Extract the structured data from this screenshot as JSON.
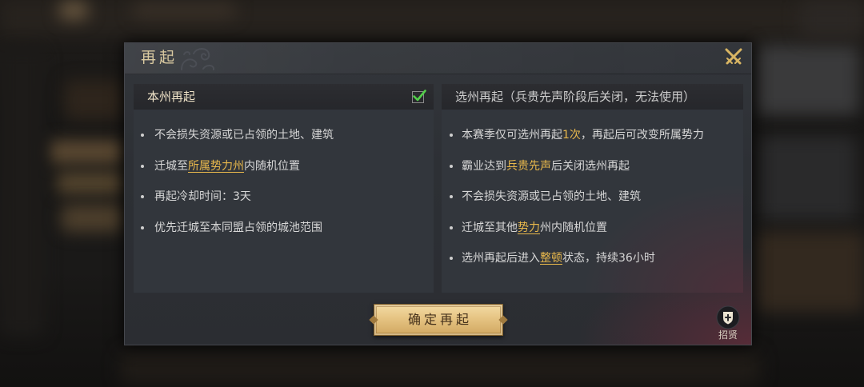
{
  "dialog": {
    "title": "再起",
    "close_icon": "close-crossed-swords-icon"
  },
  "colors": {
    "body_text": "#d6d6d6",
    "highlight": "#e8b84c",
    "title": "#d9c9a0",
    "check": "#52cf4a",
    "button_text": "#44301a"
  },
  "local_revive": {
    "title": "本州再起",
    "selected": true,
    "check_icon": "green-checkmark-icon",
    "items": [
      {
        "parts": [
          {
            "text": "不会损失资源或已占领的土地、建筑"
          }
        ]
      },
      {
        "parts": [
          {
            "text": "迁城至"
          },
          {
            "text": "所属势力州",
            "highlighted": true,
            "underlined": true
          },
          {
            "text": "内随机位置"
          }
        ]
      },
      {
        "parts": [
          {
            "text": "再起冷却时间：3天"
          }
        ]
      },
      {
        "parts": [
          {
            "text": "优先迁城至本同盟占领的城池范围"
          }
        ]
      }
    ]
  },
  "choose_state_revive": {
    "title": "选州再起（兵贵先声阶段后关闭，无法使用）",
    "items": [
      {
        "parts": [
          {
            "text": "本赛季仅可选州再起"
          },
          {
            "text": "1次",
            "highlighted": true
          },
          {
            "text": "，再起后可改变所属势力"
          }
        ]
      },
      {
        "parts": [
          {
            "text": "霸业达到"
          },
          {
            "text": "兵贵先声",
            "highlighted": true
          },
          {
            "text": "后关闭选州再起"
          }
        ]
      },
      {
        "parts": [
          {
            "text": "不会损失资源或已占领的土地、建筑"
          }
        ]
      },
      {
        "parts": [
          {
            "text": "迁城至其他"
          },
          {
            "text": "势力",
            "highlighted": true,
            "underlined": true
          },
          {
            "text": "州内随机位置"
          }
        ]
      },
      {
        "parts": [
          {
            "text": "选州再起后进入"
          },
          {
            "text": "整顿",
            "highlighted": true,
            "underlined": true
          },
          {
            "text": "状态，持续36小时"
          }
        ]
      }
    ]
  },
  "confirm_button": {
    "label": "确定再起"
  },
  "recruit": {
    "label": "招贤",
    "icon": "shield-plus-icon"
  },
  "title_ornament_icon": "cloud-ornament-icon"
}
